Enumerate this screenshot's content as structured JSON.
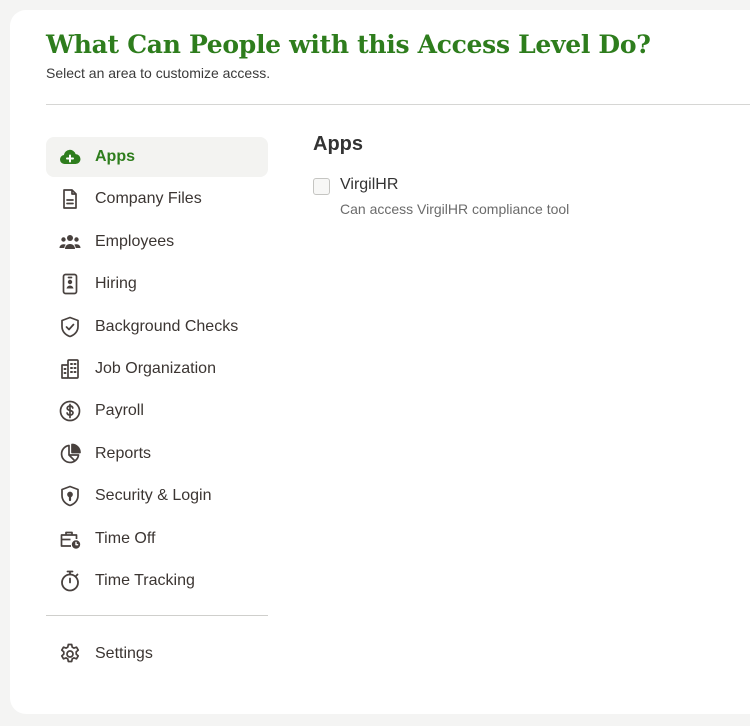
{
  "header": {
    "title": "What Can People with this Access Level Do?",
    "subtitle": "Select an area to customize access."
  },
  "sidebar": {
    "items": [
      {
        "label": "Apps",
        "icon": "cloud-plus-icon",
        "active": true
      },
      {
        "label": "Company Files",
        "icon": "document-icon"
      },
      {
        "label": "Employees",
        "icon": "people-group-icon"
      },
      {
        "label": "Hiring",
        "icon": "id-badge-icon"
      },
      {
        "label": "Background Checks",
        "icon": "shield-check-icon"
      },
      {
        "label": "Job Organization",
        "icon": "building-icon"
      },
      {
        "label": "Payroll",
        "icon": "dollar-circle-icon"
      },
      {
        "label": "Reports",
        "icon": "pie-chart-icon"
      },
      {
        "label": "Security & Login",
        "icon": "shield-lock-icon"
      },
      {
        "label": "Time Off",
        "icon": "briefcase-clock-icon"
      },
      {
        "label": "Time Tracking",
        "icon": "stopwatch-icon"
      }
    ],
    "settings": {
      "label": "Settings",
      "icon": "gear-icon"
    }
  },
  "main": {
    "section_title": "Apps",
    "permissions": [
      {
        "label": "VirgilHR",
        "description": "Can access VirgilHR compliance tool",
        "checked": false
      }
    ]
  },
  "colors": {
    "accent": "#2e7d1d",
    "active_bg": "#f3f3f1",
    "page_bg": "#f4f4f3"
  }
}
